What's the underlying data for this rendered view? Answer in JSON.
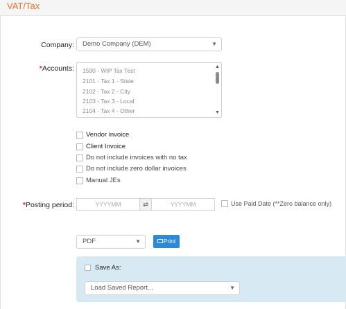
{
  "page": {
    "title": "VAT/Tax"
  },
  "company": {
    "label": "Company:",
    "value": "Demo Company (DEM)"
  },
  "accounts": {
    "required_mark": "*",
    "label": "Accounts:",
    "options": [
      "1590 - WIP Tax Test",
      "2101 - Tax 1 - State",
      "2102 - Tax 2 - City",
      "2103 - Tax 3 - Local",
      "2104 - Tax 4 - Other"
    ]
  },
  "checkboxes": {
    "vendor_invoice": "Vendor invoice",
    "client_invoice": "Client Invoice",
    "no_tax": "Do not include invoices with no tax",
    "zero_dollar": "Do not include zero dollar invoices",
    "manual_jes": "Manual JEs"
  },
  "posting_period": {
    "required_mark": "*",
    "label": "Posting period:",
    "from_placeholder": "YYYYMM",
    "to_placeholder": "YYYYMM",
    "swap_icon": "⇄",
    "use_paid_date_label": "Use Paid Date (**Zero balance only)"
  },
  "output": {
    "format": "PDF",
    "print_label": "Print"
  },
  "save": {
    "label": "Save As:",
    "load_placeholder": "Load Saved Report..."
  },
  "colors": {
    "accent": "#e8702a",
    "required": "#d9281b",
    "primary_button": "#2e8ad8",
    "panel_bg": "#d7eaf3"
  },
  "icons": {
    "dropdown": "chevron-down-icon",
    "print": "printer-icon",
    "swap": "swap-arrows-icon"
  }
}
